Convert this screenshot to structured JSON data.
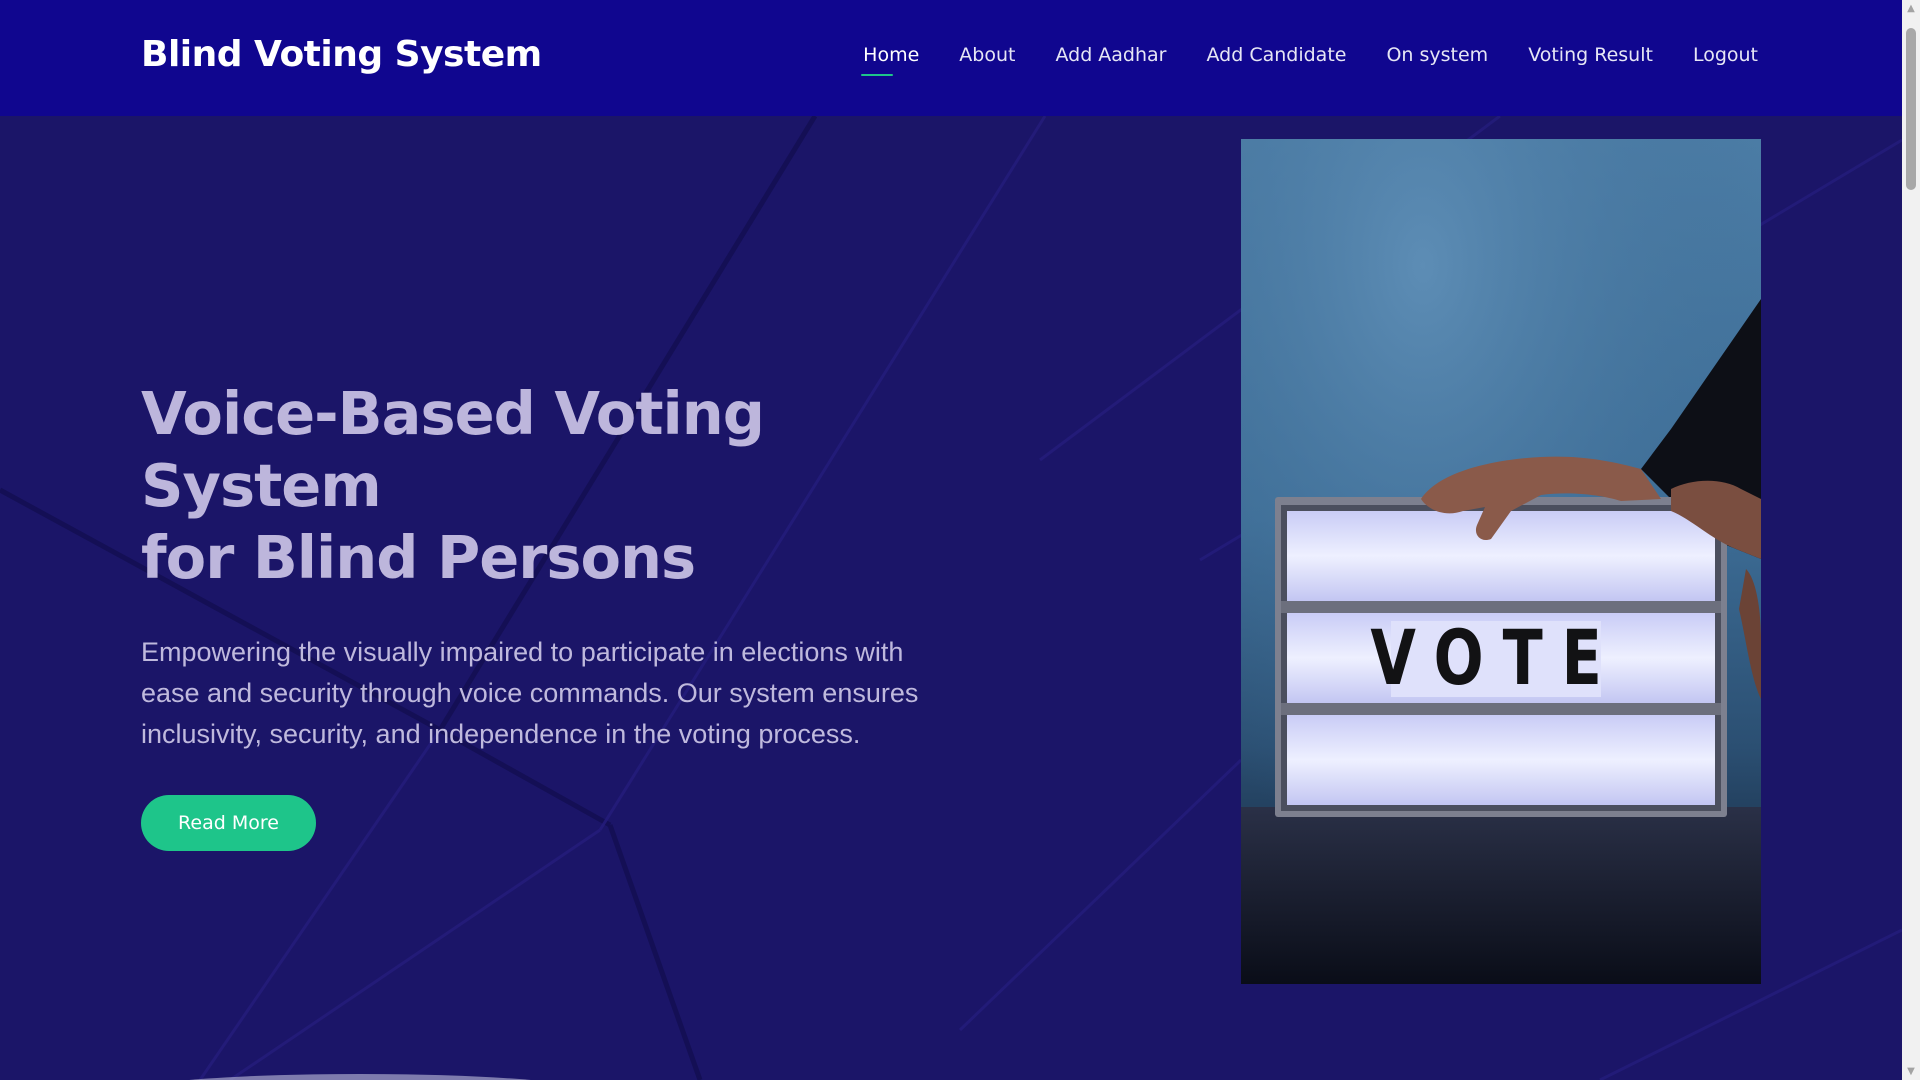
{
  "header": {
    "brand": "Blind Voting System",
    "nav": [
      {
        "label": "Home",
        "active": true
      },
      {
        "label": "About",
        "active": false
      },
      {
        "label": "Add Aadhar",
        "active": false
      },
      {
        "label": "Add Candidate",
        "active": false
      },
      {
        "label": "On system",
        "active": false
      },
      {
        "label": "Voting Result",
        "active": false
      },
      {
        "label": "Logout",
        "active": false
      }
    ]
  },
  "hero": {
    "title_line1": "Voice-Based Voting System",
    "title_line2": "for Blind Persons",
    "description": "Empowering the visually impaired to participate in elections with ease and security through voice commands. Our system ensures inclusivity, security, and independence in the voting process.",
    "button_label": "Read More",
    "image_sign_text": "VOTE"
  },
  "colors": {
    "header_bg": "#10068f",
    "hero_bg": "#1b1568",
    "accent": "#1ec58a"
  },
  "icons": {
    "scroll_up": "triangle-up",
    "scroll_down": "triangle-down"
  }
}
